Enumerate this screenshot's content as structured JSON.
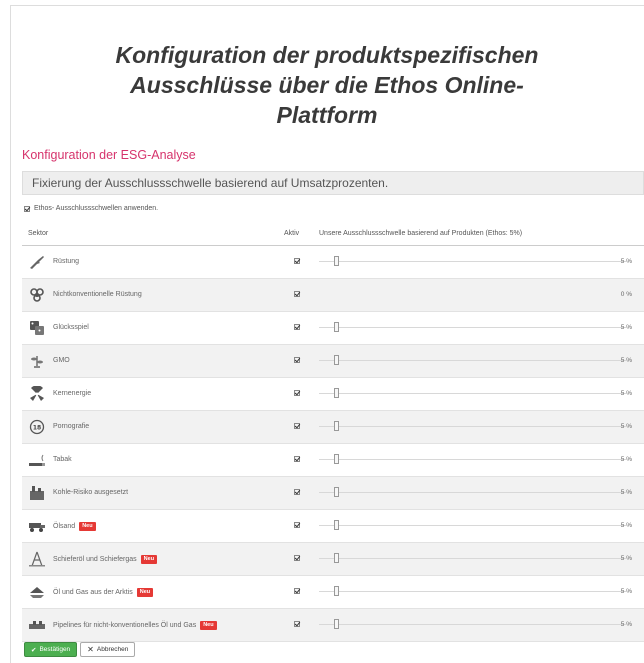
{
  "slide": {
    "title_lines": [
      "Konfiguration der produktspezifischen",
      "Ausschlüsse über die Ethos Online-",
      "Plattform"
    ]
  },
  "section": {
    "title": "Konfiguration der ESG-Analyse",
    "panel_heading": "Fixierung der Ausschlussschwelle basierend auf Umsatzprozenten.",
    "apply_label": "Ethos- Ausschlussschwellen anwenden."
  },
  "table": {
    "headers": {
      "sector": "Sektor",
      "active": "Aktiv",
      "threshold": "Unsere Ausschlussschwelle basierend auf Produkten (Ethos: 5%)"
    },
    "rows": [
      {
        "label": "Rüstung",
        "icon": "rifle-icon",
        "badge": "",
        "pct": "5 %",
        "slider_percent": 5,
        "has_slider": true
      },
      {
        "label": "Nichtkonventionelle Rüstung",
        "icon": "biohazard-icon",
        "badge": "",
        "pct": "0 %",
        "slider_percent": 0,
        "has_slider": false
      },
      {
        "label": "Glücksspiel",
        "icon": "dice-icon",
        "badge": "",
        "pct": "5 %",
        "slider_percent": 5,
        "has_slider": true
      },
      {
        "label": "GMO",
        "icon": "gmo-plant-icon",
        "badge": "",
        "pct": "5 %",
        "slider_percent": 5,
        "has_slider": true
      },
      {
        "label": "Kernenergie",
        "icon": "radiation-icon",
        "badge": "",
        "pct": "5 %",
        "slider_percent": 5,
        "has_slider": true
      },
      {
        "label": "Pornografie",
        "icon": "age-18-icon",
        "badge": "",
        "pct": "5 %",
        "slider_percent": 5,
        "has_slider": true
      },
      {
        "label": "Tabak",
        "icon": "cigarette-icon",
        "badge": "",
        "pct": "5 %",
        "slider_percent": 5,
        "has_slider": true
      },
      {
        "label": "Kohle-Risiko ausgesetzt",
        "icon": "coal-plant-icon",
        "badge": "",
        "pct": "5 %",
        "slider_percent": 5,
        "has_slider": true
      },
      {
        "label": "Ölsand",
        "icon": "oil-sand-truck-icon",
        "badge": "Neu",
        "pct": "5 %",
        "slider_percent": 5,
        "has_slider": true
      },
      {
        "label": "Schieferöl und Schiefergas",
        "icon": "drilling-rig-icon",
        "badge": "Neu",
        "pct": "5 %",
        "slider_percent": 5,
        "has_slider": true
      },
      {
        "label": "Öl und Gas aus der Arktis",
        "icon": "arctic-icon",
        "badge": "Neu",
        "pct": "5 %",
        "slider_percent": 5,
        "has_slider": true
      },
      {
        "label": "Pipelines für nicht-konventionelles Öl und Gas",
        "icon": "pipeline-icon",
        "badge": "Neu",
        "pct": "5 %",
        "slider_percent": 5,
        "has_slider": true
      }
    ]
  },
  "buttons": {
    "confirm": "Bestätigen",
    "cancel": "Abbrechen"
  },
  "colors": {
    "accent": "#d6336c",
    "confirm": "#4caf50"
  }
}
